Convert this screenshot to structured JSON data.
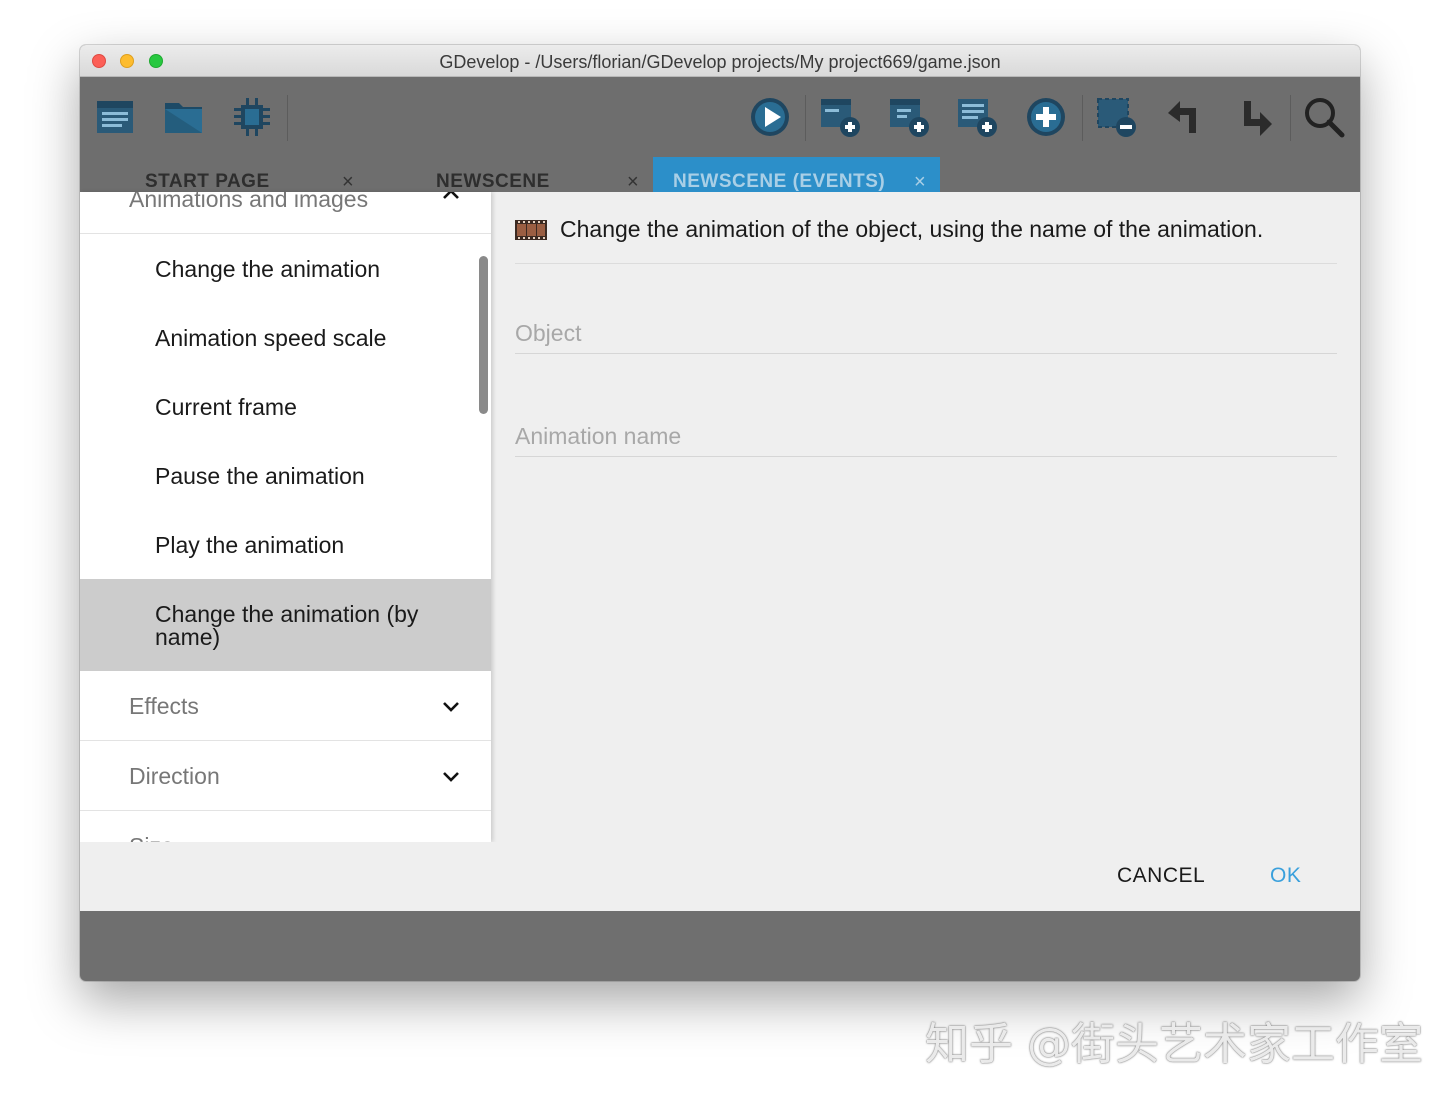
{
  "window": {
    "title": "GDevelop - /Users/florian/GDevelop projects/My project669/game.json"
  },
  "toolbar": {
    "left_icons": [
      "project-manager-icon",
      "open-folder-icon",
      "debugger-icon"
    ],
    "right_icons": [
      "preview-play-icon",
      "add-event-icon",
      "add-subevent-icon",
      "add-comment-icon",
      "add-condition-icon",
      "delete-selection-icon",
      "undo-icon",
      "redo-icon",
      "search-icon"
    ]
  },
  "tabs": [
    {
      "label": "START PAGE",
      "close": "×"
    },
    {
      "label": "NEWSCENE",
      "close": "×"
    },
    {
      "label": "NEWSCENE (EVENTS)",
      "close": "×"
    }
  ],
  "sidebar": {
    "groups": {
      "animations": {
        "label": "Animations and images",
        "expanded": true
      },
      "effects": {
        "label": "Effects",
        "expanded": false
      },
      "direction": {
        "label": "Direction",
        "expanded": false
      },
      "size": {
        "label": "Size",
        "expanded": false
      }
    },
    "items": [
      {
        "label": "Change the animation"
      },
      {
        "label": "Animation speed scale"
      },
      {
        "label": "Current frame"
      },
      {
        "label": "Pause the animation"
      },
      {
        "label": "Play the animation"
      },
      {
        "label": "Change the animation (by name)",
        "selected": true
      }
    ]
  },
  "instruction": {
    "icon": "film-strip-icon",
    "description": "Change the animation of the object, using the name of the animation."
  },
  "params": {
    "object": {
      "value": "",
      "placeholder": "Object"
    },
    "animation_name": {
      "value": "",
      "placeholder": "Animation name"
    }
  },
  "actions": {
    "cancel": "CANCEL",
    "ok": "OK"
  },
  "colors": {
    "accent": "#2c8fc9",
    "ok_text": "#3aa0dc",
    "selected_item": "#cccccc"
  },
  "watermark": "知乎 @街头艺术家工作室"
}
